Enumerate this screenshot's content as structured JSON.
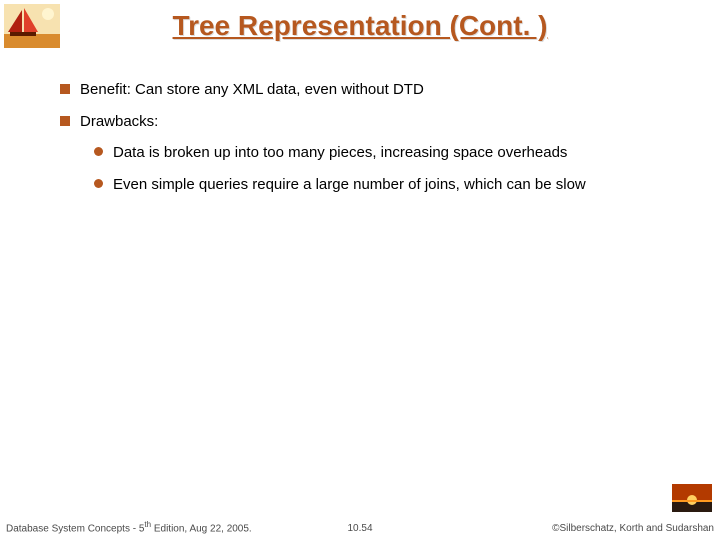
{
  "title": "Tree Representation (Cont. )",
  "bullets": {
    "b1": "Benefit: Can store any XML data, even without DTD",
    "b2": "Drawbacks:",
    "b2_1": "Data is broken up into too many pieces, increasing space overheads",
    "b2_2": "Even simple queries require a large number of joins, which can be slow"
  },
  "footer": {
    "left_a": "Database System Concepts - 5",
    "left_sup": "th",
    "left_b": " Edition, Aug 22, 2005.",
    "center": "10.54",
    "right": "©Silberschatz, Korth and Sudarshan"
  },
  "colors": {
    "accent": "#b6581f"
  }
}
